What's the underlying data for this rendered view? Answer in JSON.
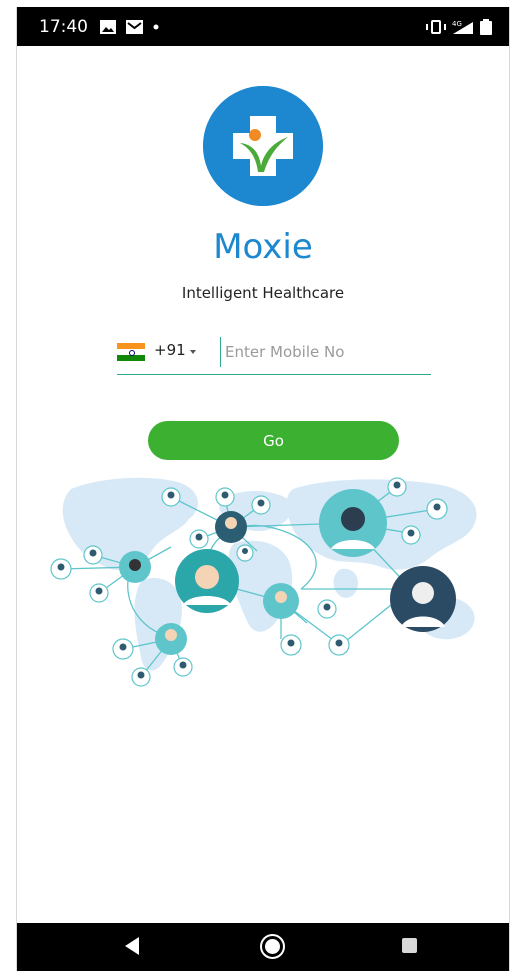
{
  "status_bar": {
    "time": "17:40",
    "icons": [
      "image-icon",
      "mail-icon",
      "dot-icon",
      "vibrate-icon",
      "signal-icon",
      "battery-icon"
    ]
  },
  "app": {
    "name": "Moxie",
    "tagline": "Intelligent Healthcare"
  },
  "login": {
    "country_code": "+91",
    "country_flag": "india-flag-icon",
    "mobile_placeholder": "Enter Mobile No",
    "mobile_value": "",
    "go_label": "Go"
  },
  "navigation": {
    "buttons": [
      "back-icon",
      "home-icon",
      "recents-icon"
    ]
  },
  "colors": {
    "brand_blue": "#1d88cf",
    "go_green": "#3cb131",
    "underline_teal": "#2ea890",
    "logo_orange": "#f08a24",
    "logo_leaf_green": "#4aaa3a",
    "map_blue": "#d7e9f7",
    "network_teal": "#5ec6cb"
  }
}
